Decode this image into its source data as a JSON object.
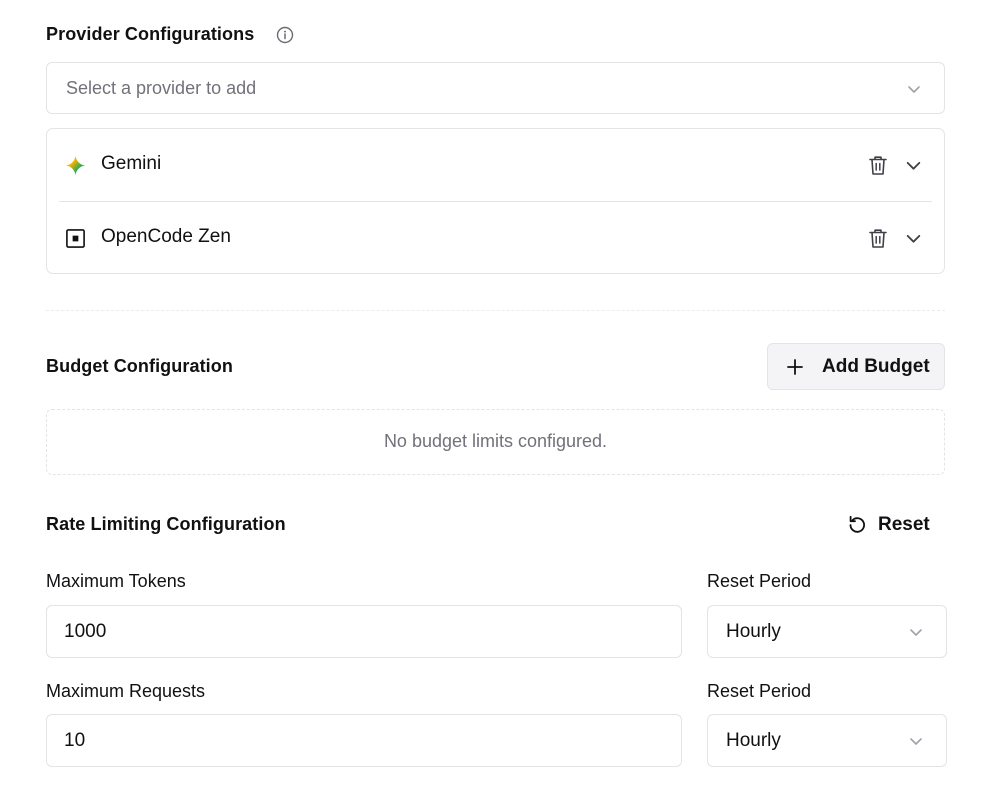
{
  "provider_section": {
    "title": "Provider Configurations",
    "info_icon": "info-circle-icon",
    "select_placeholder": "Select a provider to add",
    "providers": [
      {
        "name": "Gemini",
        "icon": "gemini-sparkle-icon"
      },
      {
        "name": "OpenCode Zen",
        "icon": "opencode-square-icon"
      }
    ]
  },
  "budget_section": {
    "title": "Budget Configuration",
    "add_button_label": "Add Budget",
    "empty_message": "No budget limits configured."
  },
  "rate_limit_section": {
    "title": "Rate Limiting Configuration",
    "reset_button_label": "Reset",
    "max_tokens_label": "Maximum Tokens",
    "max_tokens_value": "1000",
    "tokens_reset_period_label": "Reset Period",
    "tokens_reset_period_value": "Hourly",
    "max_requests_label": "Maximum Requests",
    "max_requests_value": "10",
    "requests_reset_period_label": "Reset Period",
    "requests_reset_period_value": "Hourly"
  },
  "colors": {
    "text": "#111114",
    "muted": "#71717a",
    "border": "#e4e4e8",
    "button_bg": "#f4f4f6"
  }
}
